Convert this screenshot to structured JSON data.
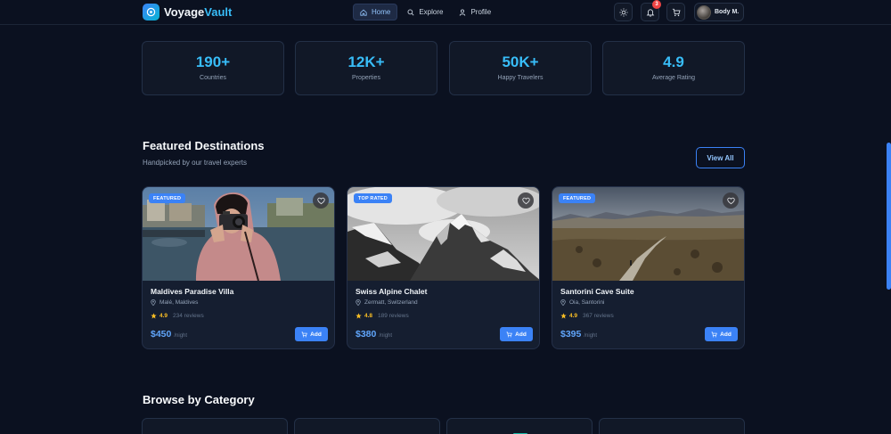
{
  "app": {
    "brand_first": "Voyage",
    "brand_second": "Vault"
  },
  "nav": {
    "items": [
      {
        "label": "Home",
        "icon": "home-icon",
        "active": true
      },
      {
        "label": "Explore",
        "icon": "search-icon",
        "active": false
      },
      {
        "label": "Profile",
        "icon": "user-icon",
        "active": false
      }
    ]
  },
  "header": {
    "notification_count": "3",
    "user_name": "Body M."
  },
  "stats": [
    {
      "value": "190+",
      "label": "Countries"
    },
    {
      "value": "12K+",
      "label": "Properties"
    },
    {
      "value": "50K+",
      "label": "Happy Travelers"
    },
    {
      "value": "4.9",
      "label": "Average Rating"
    }
  ],
  "featured": {
    "title": "Featured Destinations",
    "subtitle": "Handpicked by our travel experts",
    "view_all_label": "View All",
    "cards": [
      {
        "badge": "FEATURED",
        "title": "Maldives Paradise Villa",
        "location": "Malé, Maldives",
        "rating": "4.9",
        "reviews": "234 reviews",
        "price": "$450",
        "per": "/night",
        "add_label": "Add"
      },
      {
        "badge": "TOP RATED",
        "title": "Swiss Alpine Chalet",
        "location": "Zermatt, Switzerland",
        "rating": "4.8",
        "reviews": "189 reviews",
        "price": "$380",
        "per": "/night",
        "add_label": "Add"
      },
      {
        "badge": "FEATURED",
        "title": "Santorini Cave Suite",
        "location": "Oia, Santorini",
        "rating": "4.9",
        "reviews": "367 reviews",
        "price": "$395",
        "per": "/night",
        "add_label": "Add"
      }
    ]
  },
  "categories": {
    "title": "Browse by Category"
  },
  "colors": {
    "background": "#0b1120",
    "accent": "#3b82f6",
    "stat_value": "#38bdf8",
    "star": "#fbbf24"
  }
}
